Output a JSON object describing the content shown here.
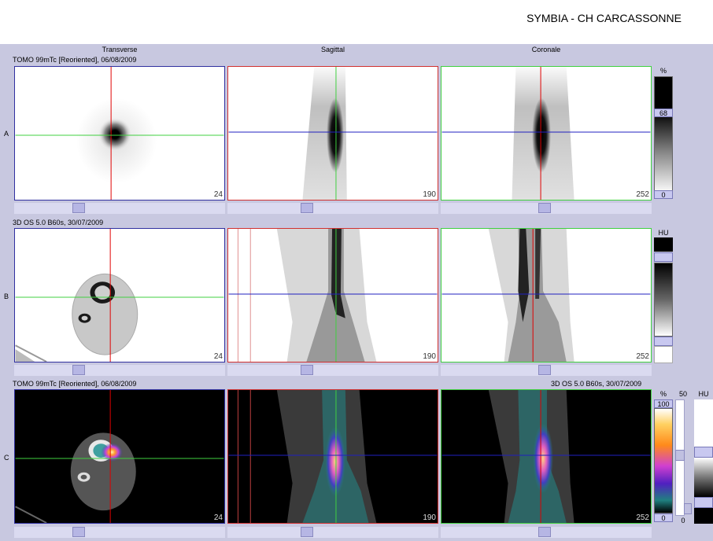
{
  "header": {
    "title": "SYMBIA - CH CARCASSONNE"
  },
  "columns": [
    "Transverse",
    "Sagittal",
    "Coronale"
  ],
  "rows": [
    {
      "label": "A",
      "series": "TOMO 99mTc [Reoriented], 06/08/2009",
      "slices": [
        "24",
        "190",
        "252"
      ]
    },
    {
      "label": "B",
      "series": "3D  OS  5.0  B60s, 30/07/2009",
      "slices": [
        "24",
        "190",
        "252"
      ]
    },
    {
      "label": "C",
      "series": "TOMO 99mTc [Reoriented], 06/08/2009",
      "series_right": "3D  OS  5.0  B60s, 30/07/2009",
      "slices": [
        "24",
        "190",
        "252"
      ]
    }
  ],
  "scales": {
    "a": {
      "unit": "%",
      "value": "68",
      "min": "0"
    },
    "b": {
      "unit": "HU"
    },
    "c": {
      "unit": "%",
      "max": "100",
      "min": "0",
      "value2": "50",
      "unit2": "HU",
      "min2": "0"
    }
  },
  "colors": {
    "background": "#c8c8e0",
    "axis_red": "#e00000",
    "axis_green": "#40d040",
    "axis_blue": "#2020c0"
  },
  "icons": [
    "slider-handle"
  ]
}
